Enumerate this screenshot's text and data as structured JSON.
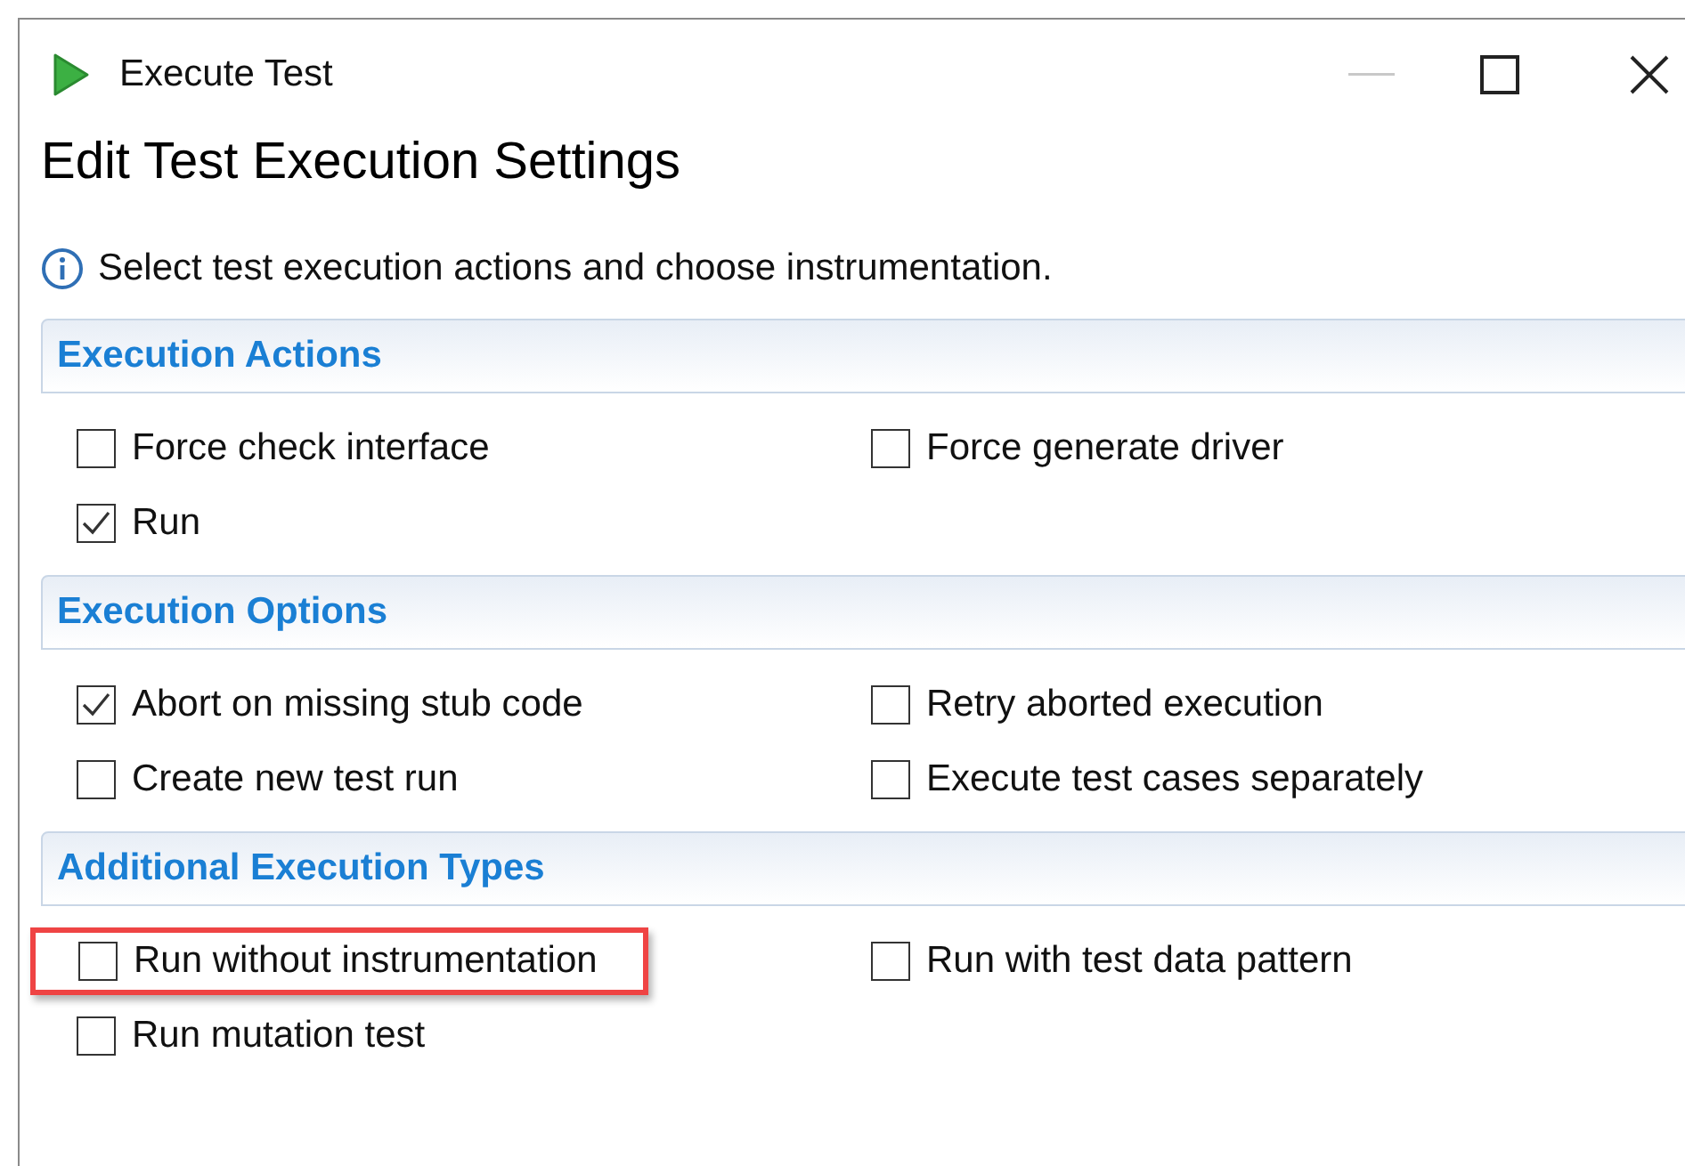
{
  "window": {
    "title": "Execute Test"
  },
  "heading": "Edit Test Execution Settings",
  "info": "Select test execution actions and choose instrumentation.",
  "sections": [
    {
      "title": "Execution Actions",
      "options": [
        {
          "label": "Force check interface",
          "checked": false,
          "highlighted": false
        },
        {
          "label": "Force generate driver",
          "checked": false,
          "highlighted": false
        },
        {
          "label": "Run",
          "checked": true,
          "highlighted": false
        }
      ]
    },
    {
      "title": "Execution Options",
      "options": [
        {
          "label": "Abort on missing stub code",
          "checked": true,
          "highlighted": false
        },
        {
          "label": "Retry aborted execution",
          "checked": false,
          "highlighted": false
        },
        {
          "label": "Create new test run",
          "checked": false,
          "highlighted": false
        },
        {
          "label": "Execute test cases separately",
          "checked": false,
          "highlighted": false
        }
      ]
    },
    {
      "title": "Additional Execution Types",
      "options": [
        {
          "label": "Run without instrumentation",
          "checked": false,
          "highlighted": true
        },
        {
          "label": "Run with test data pattern",
          "checked": false,
          "highlighted": false
        },
        {
          "label": "Run mutation test",
          "checked": false,
          "highlighted": false
        }
      ]
    }
  ]
}
